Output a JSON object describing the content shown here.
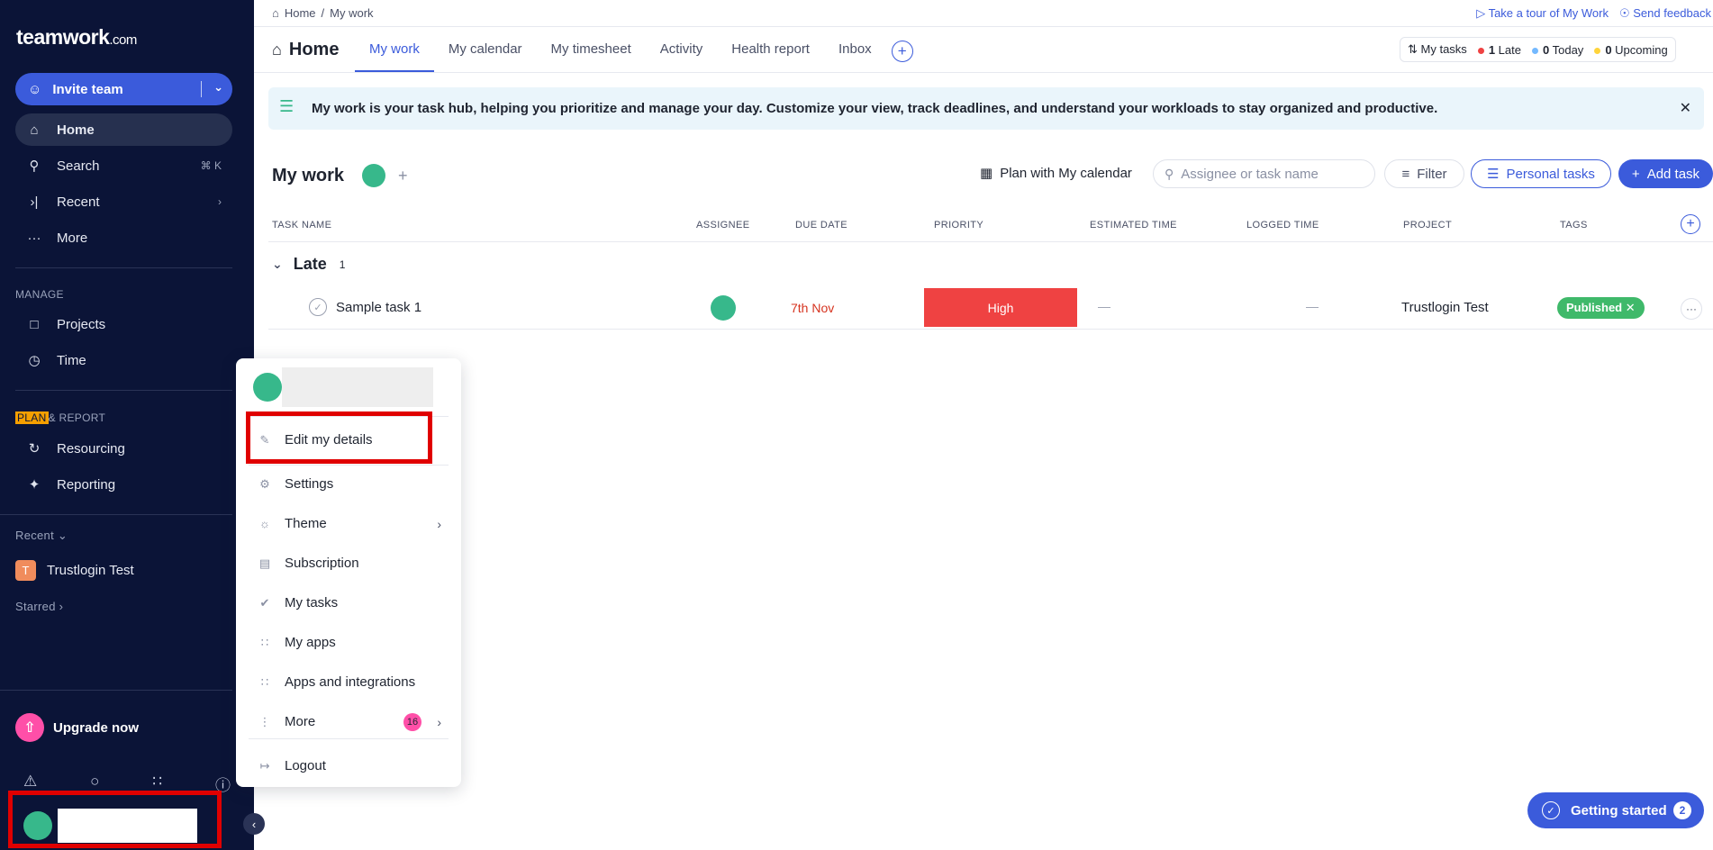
{
  "app": {
    "logo_text": "teamwork",
    "logo_suffix": ".com"
  },
  "sidebar": {
    "invite_label": "Invite team",
    "nav": [
      {
        "label": "Home",
        "icon": "home-icon"
      },
      {
        "label": "Search",
        "icon": "search-icon",
        "shortcut": "⌘ K"
      },
      {
        "label": "Recent",
        "icon": "recent-icon"
      },
      {
        "label": "More",
        "icon": "more-icon"
      }
    ],
    "manage_label": "MANAGE",
    "manage_items": [
      {
        "label": "Projects",
        "icon": "folder-icon"
      },
      {
        "label": "Time",
        "icon": "clock-icon"
      }
    ],
    "plan_label": "PLAN",
    "report_label": "& REPORT",
    "plan_items": [
      {
        "label": "Resourcing",
        "icon": "resourcing-icon"
      },
      {
        "label": "Reporting",
        "icon": "reporting-icon"
      }
    ],
    "recent_label": "Recent",
    "recent_project": {
      "initial": "T",
      "name": "Trustlogin Test"
    },
    "starred_label": "Starred",
    "upgrade_label": "Upgrade now"
  },
  "header": {
    "breadcrumb": [
      "Home",
      "/",
      "My work"
    ],
    "tour_link": "Take a tour of My Work",
    "feedback_link": "Send feedback",
    "title": "Home",
    "tabs": [
      "My work",
      "My calendar",
      "My timesheet",
      "Activity",
      "Health report",
      "Inbox"
    ],
    "summary": {
      "my_tasks": "My tasks",
      "late_count": "1",
      "late_label": "Late",
      "today_count": "0",
      "today_label": "Today",
      "upcoming_count": "0",
      "upcoming_label": "Upcoming"
    }
  },
  "banner": {
    "text": "My work is your task hub, helping you prioritize and manage your day. Customize your view, track deadlines, and understand your workloads to stay organized and productive."
  },
  "mywork": {
    "title": "My work",
    "plan_calendar": "Plan with My calendar",
    "search_placeholder": "Assignee or task name",
    "filter_label": "Filter",
    "personal_tasks_label": "Personal tasks",
    "add_task_label": "Add task"
  },
  "table": {
    "columns": [
      "TASK NAME",
      "ASSIGNEE",
      "DUE DATE",
      "PRIORITY",
      "ESTIMATED TIME",
      "LOGGED TIME",
      "PROJECT",
      "TAGS"
    ],
    "group": {
      "name": "Late",
      "count": "1"
    },
    "rows": [
      {
        "name": "Sample task 1",
        "due": "7th Nov",
        "priority": "High",
        "estimated": "—",
        "logged": "—",
        "project": "Trustlogin Test",
        "tag": "Published ✕"
      }
    ]
  },
  "menu": {
    "items": [
      {
        "label": "Edit my details",
        "icon": "pencil-icon"
      },
      {
        "label": "Settings",
        "icon": "gear-icon"
      },
      {
        "label": "Theme",
        "icon": "sun-icon"
      },
      {
        "label": "Subscription",
        "icon": "card-icon"
      },
      {
        "label": "My tasks",
        "icon": "check-circle-icon"
      },
      {
        "label": "My apps",
        "icon": "apps-icon"
      },
      {
        "label": "Apps and integrations",
        "icon": "grid-icon"
      },
      {
        "label": "More",
        "icon": "kebab-icon",
        "badge": "16"
      },
      {
        "label": "Logout",
        "icon": "logout-icon"
      }
    ]
  },
  "getting_started": {
    "label": "Getting started",
    "count": "2"
  },
  "colors": {
    "sidebar_bg": "#0b1437",
    "accent": "#3b5bdb",
    "priority_high": "#ef4242",
    "tag_published": "#3fb96a",
    "avatar": "#37b88b",
    "highlight_box": "#e00000"
  }
}
